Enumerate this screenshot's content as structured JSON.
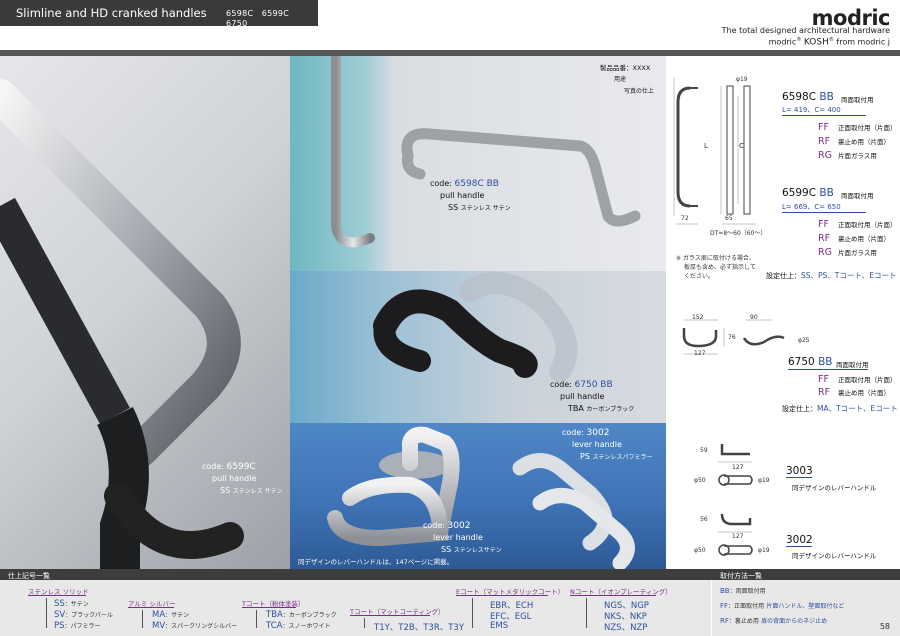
{
  "header": {
    "title": "Slimline and HD cranked handles",
    "codes": "6598C　6599C　6750",
    "logo": "modric",
    "tagline": "The total designed architectural hardware",
    "brand_modric": "modric",
    "brand_kosh": "KOSH",
    "brand_from": "from modric j"
  },
  "photo_captions": {
    "legend": [
      "製品品番：XXXX",
      "用途",
      "写真の仕上"
    ],
    "p6598c": {
      "code_label": "code:",
      "code": "6598C BB",
      "use": "pull handle",
      "finish_code": "SS",
      "finish_name": "ステンレス サテン"
    },
    "p6599c": {
      "code_label": "code:",
      "code": "6599C",
      "use": "pull handle",
      "finish_code": "SS",
      "finish_name": "ステンレス サテン"
    },
    "p6750": {
      "code_label": "code:",
      "code": "6750 BB",
      "use": "pull handle",
      "finish_code": "TBA",
      "finish_name": "カーボンブラック"
    },
    "p3002a": {
      "code_label": "code:",
      "code": "3002",
      "use": "lever handle",
      "finish_code": "PS",
      "finish_name": "ステンレスパフミラー"
    },
    "p3002b": {
      "code_label": "code:",
      "code": "3002",
      "use": "lever handle",
      "finish_code": "SS",
      "finish_name": "ステンレスサテン"
    },
    "page_ref": "同デザインのレバーハンドルは、147ページに掲載。"
  },
  "drawings": {
    "d1": {
      "dia": "φ19",
      "L": "L",
      "C": "C",
      "w72": "72",
      "w65": "65",
      "dt": "DT=8〜60（60〜）"
    },
    "d2": {
      "w152": "152",
      "w90": "90",
      "h76": "76",
      "w127": "127",
      "dia": "φ25"
    },
    "d3": {
      "h59": "59",
      "w127": "127",
      "d50": "φ50",
      "d19": "φ19"
    },
    "d4": {
      "h56": "56",
      "w127": "127",
      "d50": "φ50",
      "d19": "φ19"
    }
  },
  "products": {
    "p6598c": {
      "code_a": "6598C",
      "code_b": "BB",
      "desc": "両面取付用",
      "dims": "L= 419、C= 400",
      "mods": [
        {
          "c": "FF",
          "d": "正面取付用（片面）"
        },
        {
          "c": "RF",
          "d": "裏止め用（片面）"
        },
        {
          "c": "RG",
          "d": "片面ガラス用"
        }
      ]
    },
    "p6599c": {
      "code_a": "6599C",
      "code_b": "BB",
      "desc": "両面取付用",
      "dims": "L= 669、C= 650",
      "mods": [
        {
          "c": "FF",
          "d": "正面取付用（片面）"
        },
        {
          "c": "RF",
          "d": "裏止め用（片面）"
        },
        {
          "c": "RG",
          "d": "片面ガラス用"
        }
      ]
    },
    "glass_note": [
      "※ ガラス扉に取付ける場合、",
      "板厚も含め、必ず指示して",
      "ください。"
    ],
    "finish_1": {
      "label": "設定仕上：",
      "values": "SS、PS、Tコート、Eコート"
    },
    "p6750": {
      "code_a": "6750",
      "code_b": "BB",
      "desc": "両面取付用",
      "mods": [
        {
          "c": "FF",
          "d": "正面取付用（片面）"
        },
        {
          "c": "RF",
          "d": "裏止め用（片面）"
        }
      ]
    },
    "finish_2": {
      "label": "設定仕上：",
      "values": "MA、Tコート、Eコート"
    },
    "l3003": {
      "code": "3003",
      "desc": "同デザインのレバーハンドル"
    },
    "l3002": {
      "code": "3002",
      "desc": "同デザインのレバーハンドル"
    }
  },
  "finish_legend": {
    "title": "仕上記号一覧",
    "groups": [
      {
        "name": "ステンレス ソリッド",
        "items": [
          {
            "c": "SS",
            "d": "：サテン"
          },
          {
            "c": "SV",
            "d": "：ブラックパール"
          },
          {
            "c": "PS",
            "d": "：パフミラー"
          }
        ]
      },
      {
        "name": "アルミ シルバー",
        "items": [
          {
            "c": "MA",
            "d": "：サテン"
          },
          {
            "c": "MV",
            "d": "：スパークリングシルバー"
          }
        ]
      },
      {
        "name": "Tコート（粉体塗装）",
        "items": [
          {
            "c": "TBA",
            "d": "：カーボンブラック"
          },
          {
            "c": "TCA",
            "d": "：スノーホワイト"
          }
        ]
      },
      {
        "name": "Tコート（マットコーティング）",
        "items": [
          {
            "c": "T1Y、T2B、T3R、T3Y",
            "d": ""
          }
        ]
      },
      {
        "name": "Eコート（マットメタリックコート）",
        "items": [
          {
            "c": "EBR、ECH",
            "d": ""
          },
          {
            "c": "EFC、EGL",
            "d": ""
          },
          {
            "c": "EMS",
            "d": ""
          }
        ]
      },
      {
        "name": "Nコート（イオンプレーティング）",
        "items": [
          {
            "c": "NGS、NGP",
            "d": ""
          },
          {
            "c": "NKS、NKP",
            "d": ""
          },
          {
            "c": "NZS、NZP",
            "d": ""
          }
        ]
      }
    ]
  },
  "mounting_legend": {
    "title": "取付方法一覧",
    "items": [
      {
        "c": "BB",
        "d": "：両面取付用",
        "e": ""
      },
      {
        "c": "FF",
        "d": "：正面取付用",
        "e": "片面ハンドル、壁面取付など"
      },
      {
        "c": "RF",
        "d": "：裏止め用",
        "e": "扉の背面からのネジ止め"
      }
    ]
  },
  "page_number": "58",
  "colors": {
    "accent_blue": "#2e4fa0",
    "accent_purple": "#7a2f88",
    "dark_bar": "#3a3a3a"
  }
}
